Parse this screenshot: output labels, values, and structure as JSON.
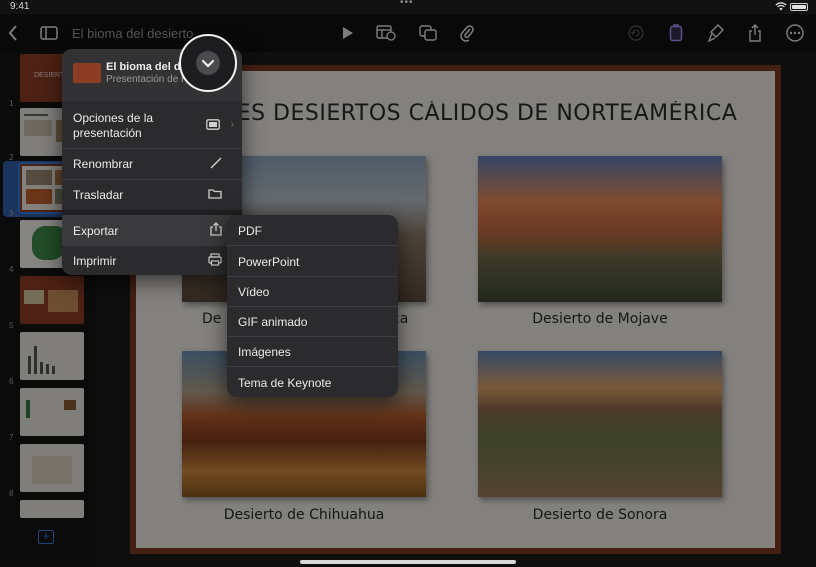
{
  "status": {
    "time": "9:41"
  },
  "toolbar": {
    "doc_title": "El bioma del desierto",
    "icons": [
      "back-chevron-icon",
      "sidebar-icon",
      "play-icon",
      "table-icon",
      "shapes-icon",
      "attachment-icon",
      "undo-icon",
      "document-icon",
      "format-brush-icon",
      "share-icon",
      "more-icon"
    ],
    "accent": "#a98ef7"
  },
  "sidebar": {
    "slides": [
      {
        "num": "1",
        "thumb_title": "DESIERTO"
      },
      {
        "num": "2",
        "thumb_title": ""
      },
      {
        "num": "3",
        "thumb_title": ""
      },
      {
        "num": "4",
        "thumb_title": ""
      },
      {
        "num": "5",
        "thumb_title": ""
      },
      {
        "num": "6",
        "thumb_title": ""
      },
      {
        "num": "7",
        "thumb_title": ""
      },
      {
        "num": "8",
        "thumb_title": ""
      }
    ],
    "selected": "3",
    "selection_color": "#3d7be0"
  },
  "slide": {
    "title": "PALES DESIERTOS CÁLIDOS DE NORTEAMÉRICA",
    "captions": {
      "mojave": "Desierto de Mojave",
      "chihuahua": "Desierto de Chihuahua",
      "sonora": "Desierto de Sonora",
      "top_left_partial_start": "De",
      "top_left_partial_end": "ca"
    },
    "frame_color": "#7a3a22"
  },
  "menu": {
    "header_title": "El bioma del de",
    "header_subtitle": "Presentación de K",
    "items": [
      {
        "label": "Opciones de la\npresentación",
        "icon": "screen-icon"
      },
      {
        "label": "Renombrar",
        "icon": "pencil-icon"
      },
      {
        "label": "Trasladar",
        "icon": "folder-icon"
      },
      {
        "label": "Exportar",
        "icon": "export-icon"
      },
      {
        "label": "Imprimir",
        "icon": "printer-icon"
      }
    ]
  },
  "submenu": {
    "items": [
      "PDF",
      "PowerPoint",
      "Vídeo",
      "GIF animado",
      "Imágenes",
      "Tema de Keynote"
    ]
  }
}
